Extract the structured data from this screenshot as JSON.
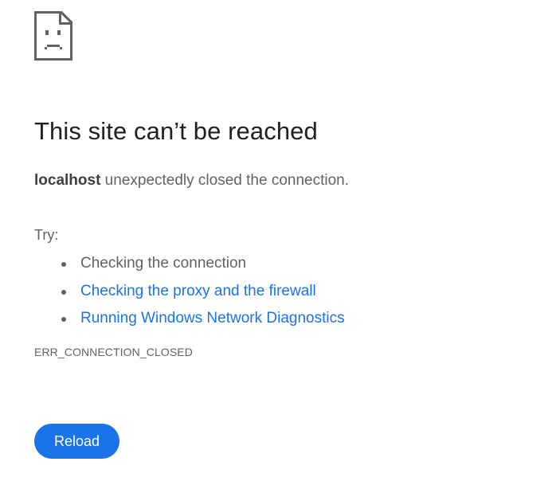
{
  "error": {
    "icon": "sad-page-icon",
    "title": "This site can’t be reached",
    "host": "localhost",
    "summary_rest": " unexpectedly closed the connection.",
    "try_label": "Try:",
    "suggestions": [
      {
        "label": "Checking the connection",
        "is_link": false
      },
      {
        "label": "Checking the proxy and the firewall",
        "is_link": true
      },
      {
        "label": "Running Windows Network Diagnostics",
        "is_link": true
      }
    ],
    "code": "ERR_CONNECTION_CLOSED"
  },
  "actions": {
    "reload_label": "Reload"
  },
  "colors": {
    "accent": "#1a73e8",
    "title_text": "#202124",
    "secondary_text": "#5f6368",
    "link": "#1a73e8",
    "background": "#ffffff"
  }
}
